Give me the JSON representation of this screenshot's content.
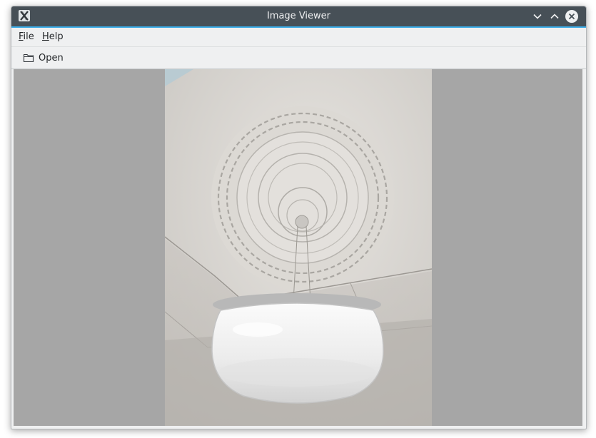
{
  "window": {
    "title": "Image Viewer",
    "app_icon": "x-app-icon"
  },
  "titlebar_buttons": [
    {
      "name": "minimize",
      "icon": "chevron-down-icon"
    },
    {
      "name": "maximize",
      "icon": "chevron-up-icon"
    },
    {
      "name": "close",
      "icon": "close-icon"
    }
  ],
  "menubar": {
    "items": [
      {
        "label_mnemonic": "F",
        "label_rest": "ile"
      },
      {
        "label_mnemonic": "H",
        "label_rest": "elp"
      }
    ]
  },
  "toolbar": {
    "open_label": "Open",
    "open_icon": "folder-open-icon"
  },
  "viewer": {
    "background_color": "#a6a6a6",
    "image_subject": "ceiling-lamp-photo"
  },
  "colors": {
    "titlebar": "#475057",
    "accent": "#3daee9",
    "window_bg": "#eff0f1"
  }
}
